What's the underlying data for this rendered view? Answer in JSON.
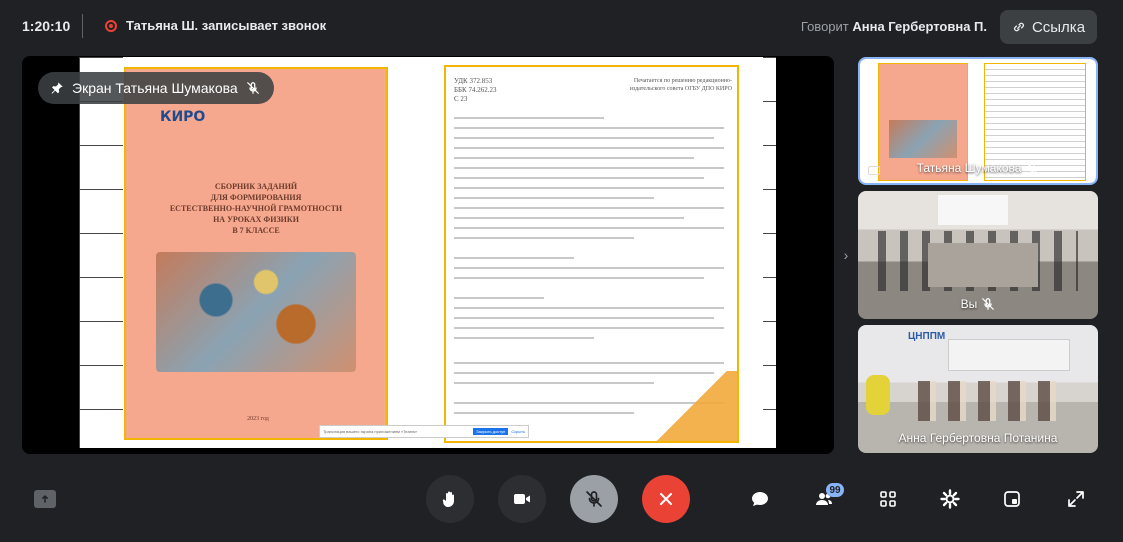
{
  "header": {
    "time": "1:20:10",
    "recording_text": "Татьяна Ш. записывает звонок",
    "speaking_prefix": "Говорит",
    "speaking_name": "Анна Гербертовна П.",
    "link_label": "Ссылка"
  },
  "main_stage": {
    "screen_label": "Экран Татьяна Шумакова",
    "book_logo": "КИРО",
    "book_title_lines": [
      "СБОРНИК ЗАДАНИЙ",
      "ДЛЯ ФОРМИРОВАНИЯ",
      "ЕСТЕСТВЕННО-НАУЧНОЙ ГРАМОТНОСТИ",
      "НА УРОКАХ ФИЗИКИ",
      "В 7 КЛАССЕ"
    ],
    "book_year": "2023 год",
    "page_header_lines": [
      "УДК 372.853",
      "ББК 74.262.23",
      "С 23"
    ],
    "page_right_header": "Печатается по решению редакционно-издательского совета ОГБУ ДПО КИРО",
    "caption_bar": {
      "text": "Трансляция вашего экрана приложением «Teams»",
      "stop_button": "Закрыть доступ",
      "hide_link": "Скрыть"
    }
  },
  "side_tiles": [
    {
      "name": "Татьяна Шумакова",
      "muted": true
    },
    {
      "name": "Вы",
      "muted": true
    },
    {
      "name": "Анна Гербертовна Потанина",
      "room_logo": "ЦНППМ"
    }
  ],
  "controls": {
    "participants_count": "99"
  },
  "colors": {
    "background": "#202124",
    "end_call": "#ea4335",
    "accent": "#8ab4f8",
    "book_cover": "#f6a88e",
    "book_border": "#f2b600"
  }
}
